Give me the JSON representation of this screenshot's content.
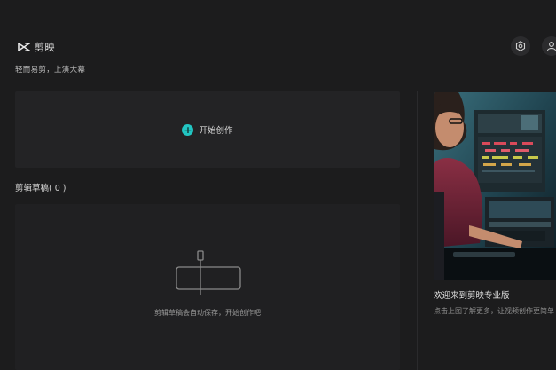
{
  "header": {
    "app_name": "剪映",
    "slogan": "轻而易剪，上演大幕",
    "logo_icon": "capcut-logo-icon",
    "settings_icon": "settings-icon",
    "user_icon": "user-icon"
  },
  "create": {
    "label": "开始创作",
    "icon": "plus-circle-icon",
    "accent_color": "#22c5c2"
  },
  "drafts": {
    "title": "剪辑草稿( 0 )",
    "empty_message": "剪辑草稿会自动保存，开始创作吧",
    "empty_icon": "timeline-illustration-icon"
  },
  "promo": {
    "title": "欢迎来到剪映专业版",
    "description": "点击上图了解更多，让视频创作更简单"
  }
}
